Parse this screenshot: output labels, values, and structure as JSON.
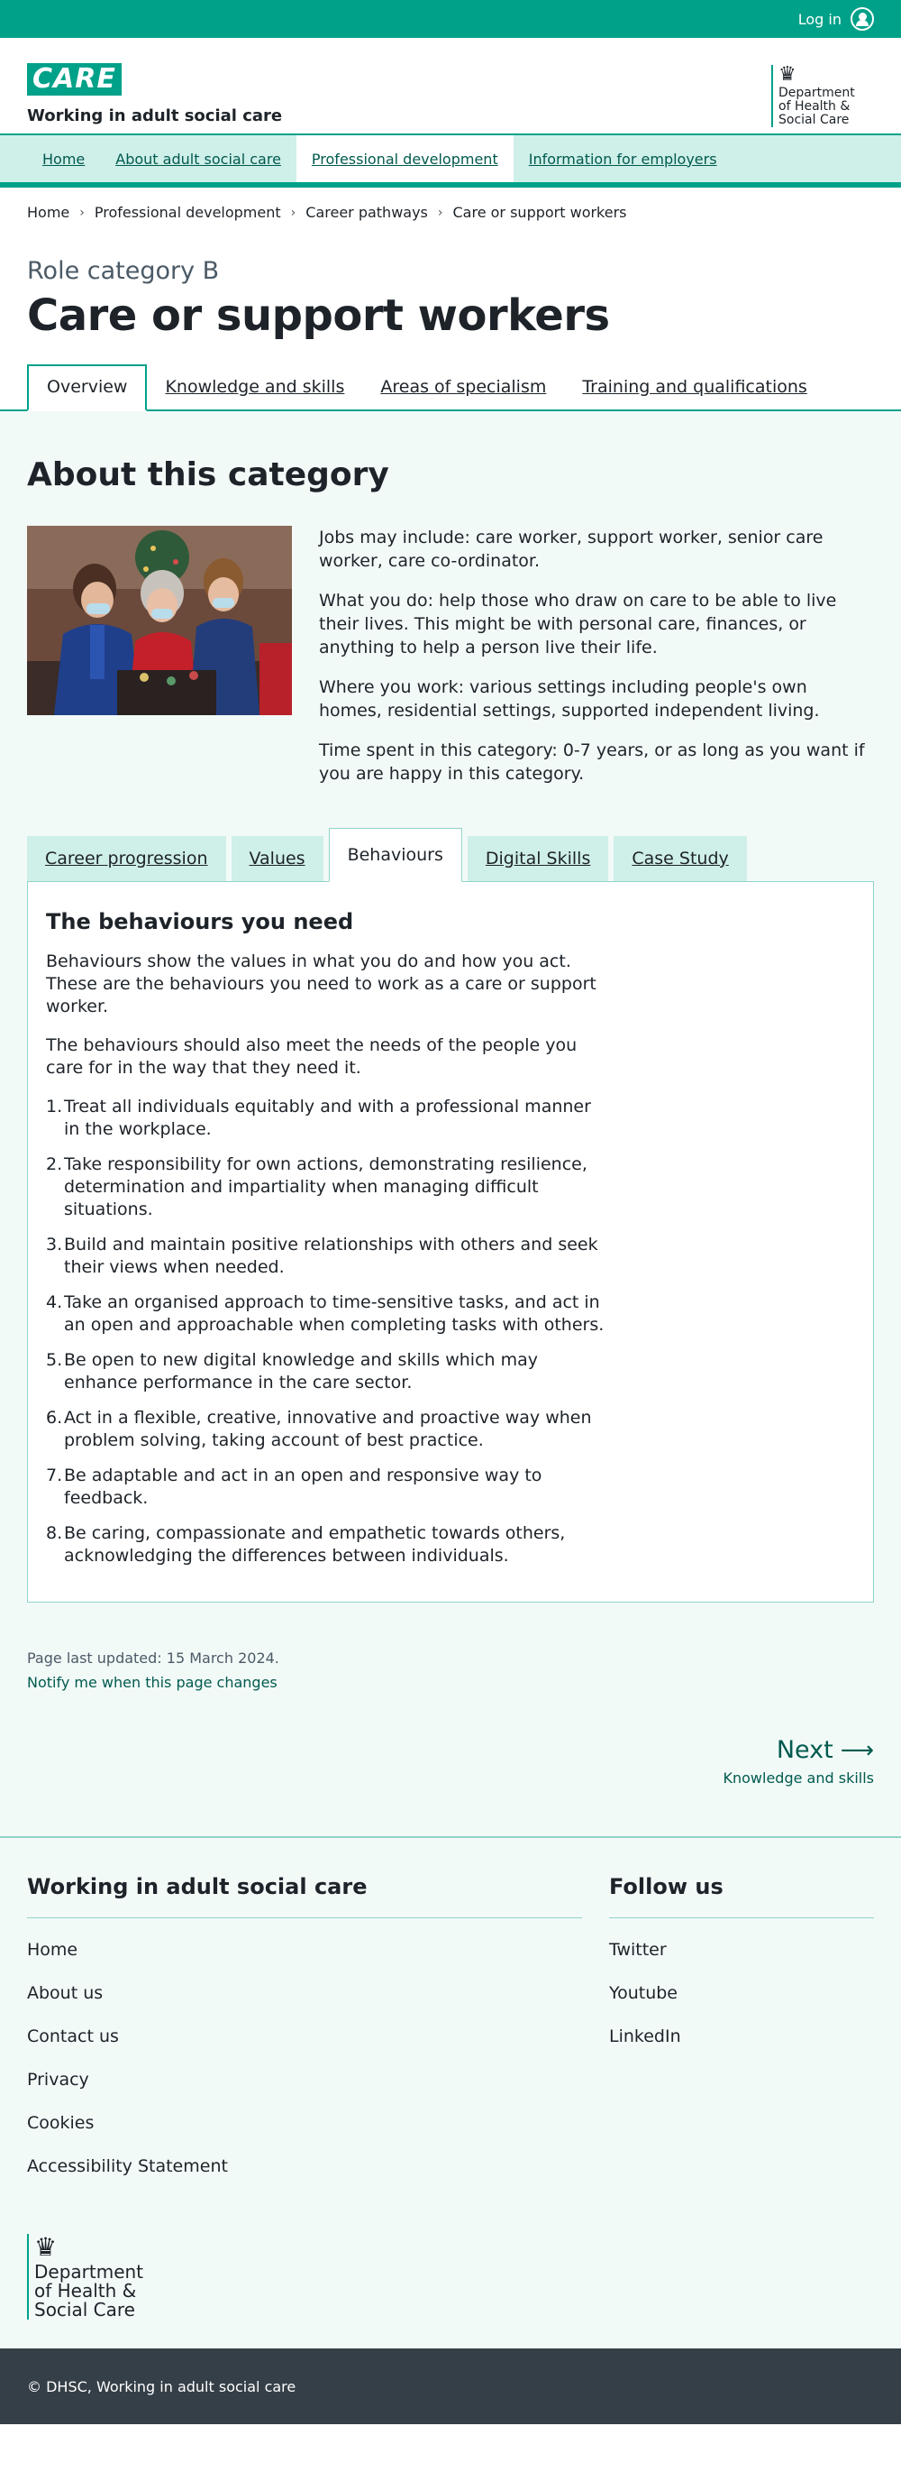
{
  "topbar": {
    "login_label": "Log in"
  },
  "header": {
    "logo_text": "CARE",
    "site_name": "Working in adult social care",
    "dhsc": "Department of Health & Social Care",
    "crest_icon": "royal-crest"
  },
  "nav": {
    "items": [
      "Home",
      "About adult social care",
      "Professional development",
      "Information for employers"
    ],
    "active": "Professional development"
  },
  "breadcrumb": {
    "items": [
      "Home",
      "Professional development",
      "Career pathways",
      "Care or support workers"
    ]
  },
  "page": {
    "caption": "Role category B",
    "title": "Care or support workers",
    "tabs": [
      "Overview",
      "Knowledge and skills",
      "Areas of specialism",
      "Training and qualifications"
    ],
    "active_tab": "Overview"
  },
  "about": {
    "title": "About this category",
    "paragraphs": [
      "Jobs may include: care worker, support worker, senior care worker, care co-ordinator.",
      "What you do: help those who draw on care to be able to live their lives. This might be with personal care, finances, or anything to help a person live their life.",
      "Where you work: various settings including people's own homes, residential settings, supported independent living.",
      "Time spent in this category: 0-7 years, or as long as you want if you are happy in this category."
    ]
  },
  "subtabs": {
    "items": [
      "Career progression",
      "Values",
      "Behaviours",
      "Digital Skills",
      "Case Study"
    ],
    "active": "Behaviours"
  },
  "behaviours": {
    "title": "The behaviours you need",
    "intro": [
      "Behaviours show the values in what you do and how you act. These are the behaviours you need to work as a care or support worker.",
      "The behaviours should also meet the needs of the people you care for in the way that they need it."
    ],
    "list": [
      "Treat all individuals equitably and with a professional manner in the workplace.",
      "Take responsibility for own actions, demonstrating resilience, determination and impartiality when managing difficult situations.",
      "Build and maintain positive relationships with others and seek their views when needed.",
      "Take an organised approach to time-sensitive tasks, and act in an open and approachable when completing tasks with others.",
      "Be open to new digital knowledge and skills which may enhance performance in the care sector.",
      "Act in a flexible, creative, innovative and proactive way when problem solving, taking account of best practice.",
      "Be adaptable and act in an open and responsive way to feedback.",
      "Be caring, compassionate and empathetic towards others, acknowledging the differences between individuals."
    ]
  },
  "meta": {
    "updated": "Page last updated: 15 March 2024.",
    "notify": "Notify me when this page changes"
  },
  "next": {
    "label": "Next",
    "link": "Knowledge and skills"
  },
  "footer": {
    "left_title": "Working in adult social care",
    "left_links": [
      "Home",
      "About us",
      "Contact us",
      "Privacy",
      "Cookies",
      "Accessibility Statement"
    ],
    "right_title": "Follow us",
    "right_links": [
      "Twitter",
      "Youtube",
      "LinkedIn"
    ],
    "dhsc": "Department of Health & Social Care",
    "copyright": "© DHSC, Working in adult social care"
  },
  "colors": {
    "brand": "#00a189",
    "nav_bg": "#cfefe9",
    "content_bg": "#f2faf8",
    "link": "#005a4e",
    "footer_bar": "#353f47"
  }
}
